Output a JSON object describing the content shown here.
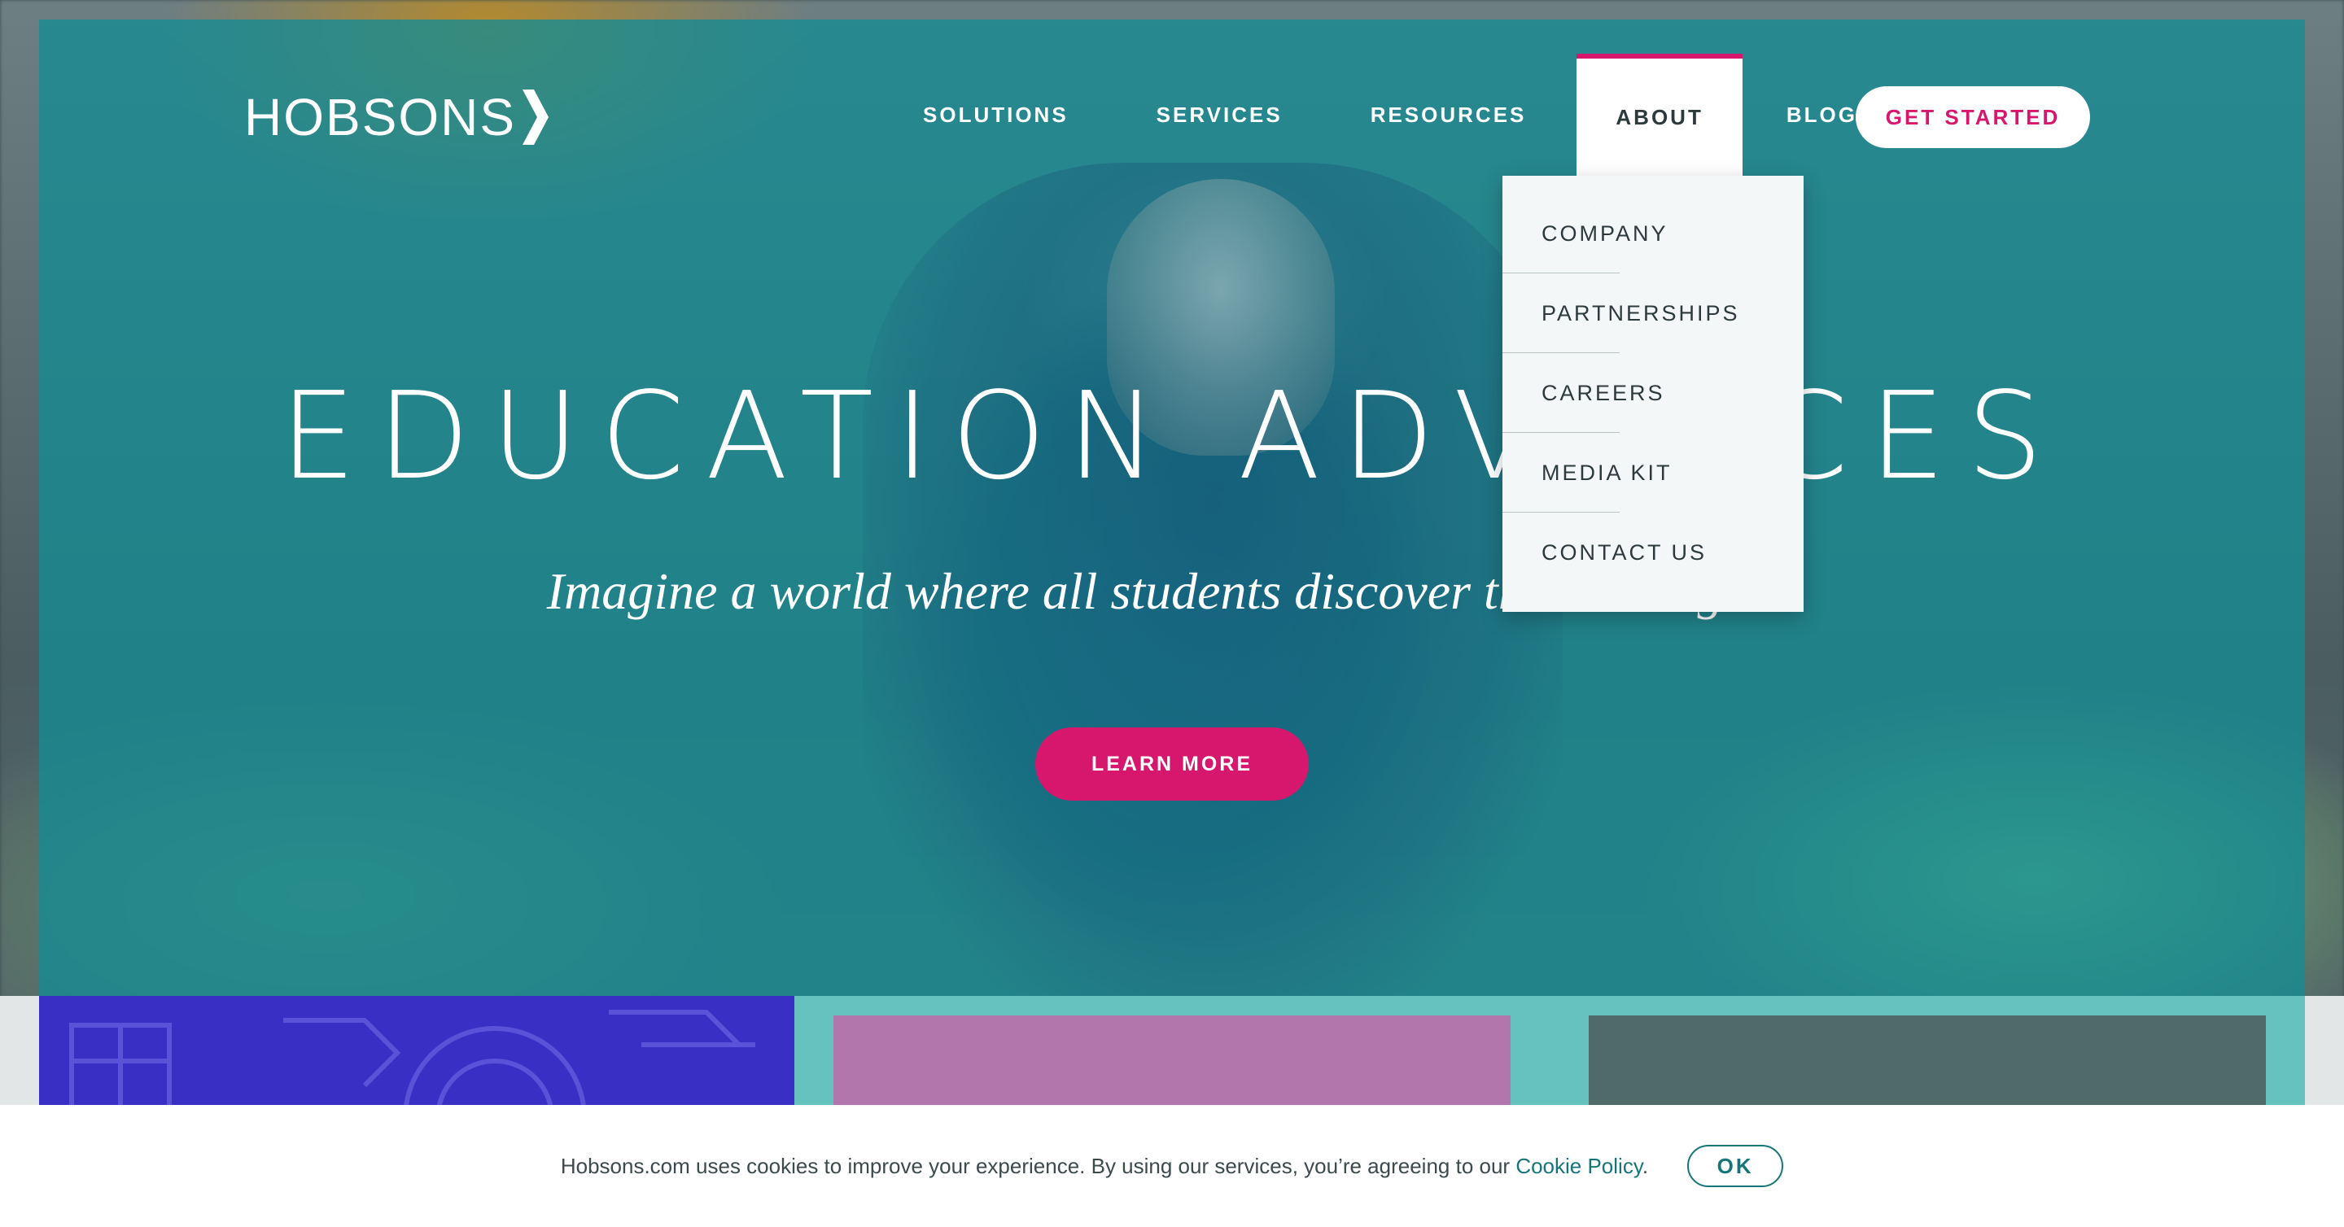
{
  "brand": {
    "logo_text": "HOBSONS",
    "accent_color": "#d6176d",
    "teal_color": "#148c94"
  },
  "nav": {
    "items": [
      {
        "label": "SOLUTIONS"
      },
      {
        "label": "SERVICES"
      },
      {
        "label": "RESOURCES"
      },
      {
        "label": "ABOUT",
        "active": true
      },
      {
        "label": "BLOG"
      }
    ],
    "cta_label": "GET STARTED"
  },
  "about_dropdown": {
    "items": [
      {
        "label": "COMPANY"
      },
      {
        "label": "PARTNERSHIPS"
      },
      {
        "label": "CAREERS"
      },
      {
        "label": "MEDIA KIT"
      },
      {
        "label": "CONTACT US"
      }
    ]
  },
  "hero": {
    "title": "EDUCATION ADVANCES",
    "subtitle": "Imagine a world where all students discover their strengths.",
    "button_label": "LEARN MORE"
  },
  "cookie": {
    "text": "Hobsons.com uses cookies to improve your experience. By using our services, you’re agreeing to our ",
    "link_text": "Cookie Policy",
    "suffix": ".",
    "ok_label": "OK"
  },
  "icons": {
    "logo_mark": "chevron-right-icon"
  }
}
